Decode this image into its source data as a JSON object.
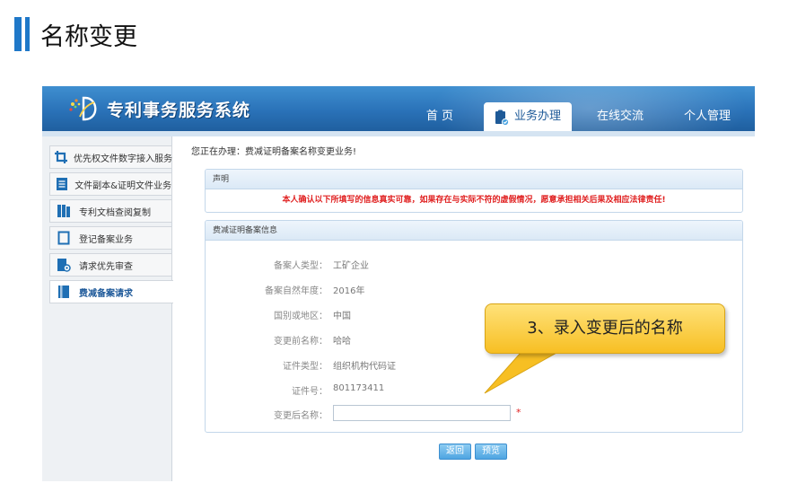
{
  "slide": {
    "title": "名称变更"
  },
  "app": {
    "name": "专利事务服务系统",
    "nav": [
      {
        "label": "首 页"
      },
      {
        "label": "业务办理"
      },
      {
        "label": "在线交流"
      },
      {
        "label": "个人管理"
      }
    ]
  },
  "sidebar": {
    "items": [
      {
        "label": "优先权文件数字接入服务"
      },
      {
        "label": "文件副本&证明文件业务"
      },
      {
        "label": "专利文档查阅复制"
      },
      {
        "label": "登记备案业务"
      },
      {
        "label": "请求优先审查"
      },
      {
        "label": "费减备案请求"
      }
    ]
  },
  "main": {
    "welcome": "您正在办理：费减证明备案名称变更业务!",
    "declaration": {
      "header": "声明",
      "text": "本人确认以下所填写的信息真实可靠，如果存在与实际不符的虚假情况，愿意承担相关后果及相应法律责任!"
    },
    "info": {
      "header": "费减证明备案信息",
      "rows": [
        {
          "label": "备案人类型：",
          "value": "工矿企业"
        },
        {
          "label": "备案自然年度：",
          "value": "2016年"
        },
        {
          "label": "国别或地区：",
          "value": "中国"
        },
        {
          "label": "变更前名称：",
          "value": "哈哈"
        },
        {
          "label": "证件类型：",
          "value": "组织机构代码证"
        },
        {
          "label": "证件号：",
          "value": "801173411"
        }
      ],
      "new_name_label": "变更后名称：",
      "new_name_value": "",
      "required_mark": "*"
    },
    "buttons": {
      "back": "返回",
      "preview": "预览"
    }
  },
  "callout": {
    "text": "3、录入变更后的名称"
  },
  "colors": {
    "accent": "#1f78c8",
    "header": "#2a72b8",
    "warning": "#e02020",
    "callout": "#f7bf23"
  }
}
